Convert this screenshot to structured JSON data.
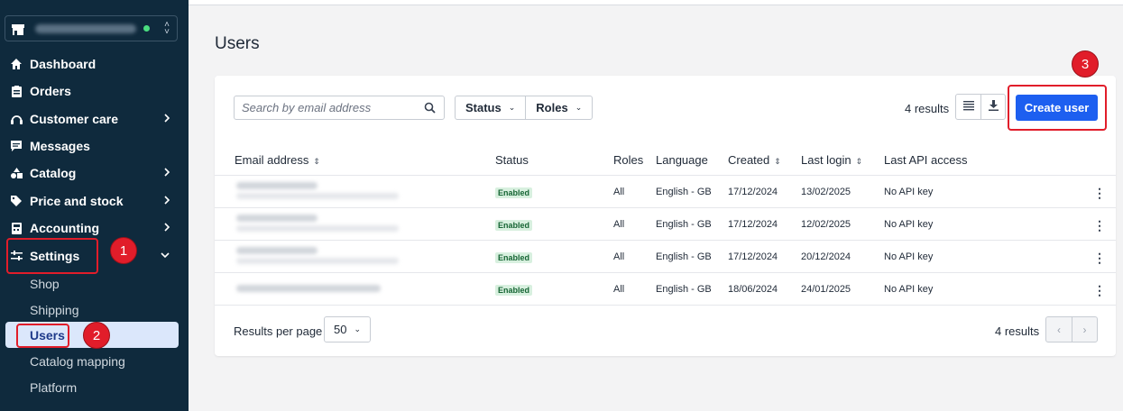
{
  "sidebar": {
    "nav": [
      {
        "label": "Dashboard",
        "icon": "home-icon",
        "chevron": false
      },
      {
        "label": "Orders",
        "icon": "clipboard-icon",
        "chevron": false
      },
      {
        "label": "Customer care",
        "icon": "headset-icon",
        "chevron": true
      },
      {
        "label": "Messages",
        "icon": "chat-icon",
        "chevron": false
      },
      {
        "label": "Catalog",
        "icon": "shapes-icon",
        "chevron": true
      },
      {
        "label": "Price and stock",
        "icon": "tag-icon",
        "chevron": true
      },
      {
        "label": "Accounting",
        "icon": "calculator-icon",
        "chevron": true
      },
      {
        "label": "Settings",
        "icon": "sliders-icon",
        "chevron": true
      }
    ],
    "settings_sub": [
      "Shop",
      "Shipping",
      "Users",
      "Catalog mapping",
      "Platform"
    ]
  },
  "page": {
    "title": "Users"
  },
  "toolbar": {
    "search_placeholder": "Search by email address",
    "status_label": "Status",
    "roles_label": "Roles",
    "results": "4 results",
    "create_label": "Create user"
  },
  "table": {
    "headers": {
      "email": "Email address",
      "status": "Status",
      "roles": "Roles",
      "language": "Language",
      "created": "Created",
      "last_login": "Last login",
      "api": "Last API access"
    },
    "rows": [
      {
        "status": "Enabled",
        "roles": "All",
        "language": "English - GB",
        "created": "17/12/2024",
        "last_login": "13/02/2025",
        "api": "No API key"
      },
      {
        "status": "Enabled",
        "roles": "All",
        "language": "English - GB",
        "created": "17/12/2024",
        "last_login": "12/02/2025",
        "api": "No API key"
      },
      {
        "status": "Enabled",
        "roles": "All",
        "language": "English - GB",
        "created": "17/12/2024",
        "last_login": "20/12/2024",
        "api": "No API key"
      },
      {
        "status": "Enabled",
        "roles": "All",
        "language": "English - GB",
        "created": "18/06/2024",
        "last_login": "24/01/2025",
        "api": "No API key"
      }
    ]
  },
  "footer": {
    "per_page_label": "Results per page",
    "per_page_value": "50",
    "results": "4 results"
  },
  "annotations": [
    "1",
    "2",
    "3"
  ],
  "colors": {
    "sidebar_bg": "#0f2a3d",
    "primary": "#1d5ff0",
    "annotation": "#e11d2a",
    "enabled_bg": "#d8f0df"
  }
}
